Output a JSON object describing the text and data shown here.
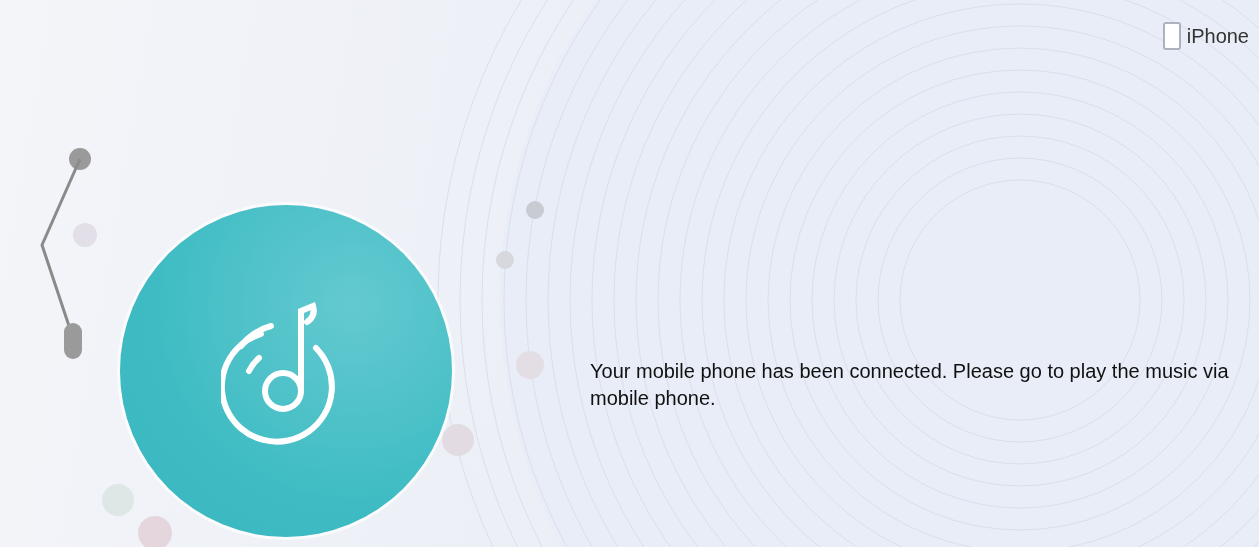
{
  "device": {
    "label": "iPhone"
  },
  "message": "Your mobile phone has been connected. Please go to play the music via mobile phone."
}
